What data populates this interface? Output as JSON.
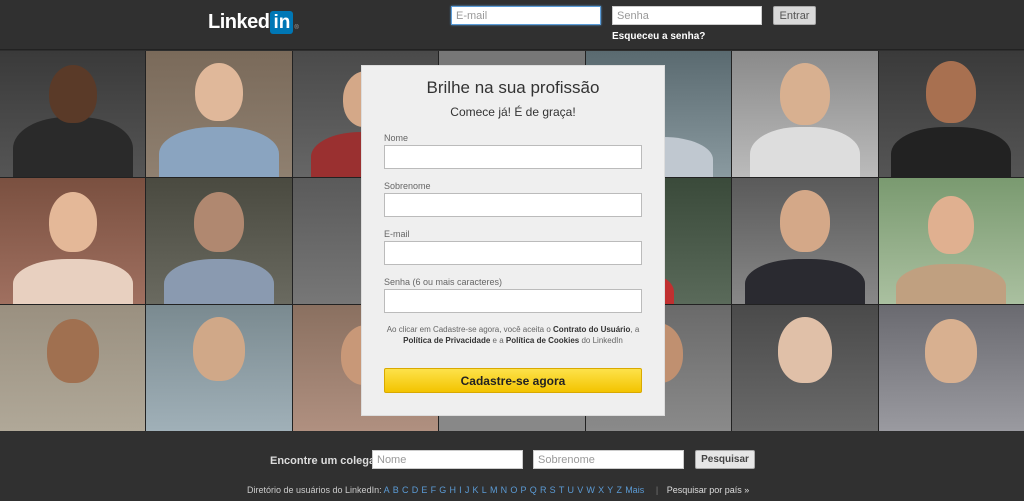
{
  "header": {
    "logo_text": "Linked",
    "logo_in": "in",
    "logo_reg": "®",
    "email_placeholder": "E-mail",
    "password_placeholder": "Senha",
    "login_button": "Entrar",
    "forgot_link": "Esqueceu a senha?"
  },
  "signup": {
    "title": "Brilhe na sua profissão",
    "subtitle": "Comece já! É de graça!",
    "first_name_label": "Nome",
    "last_name_label": "Sobrenome",
    "email_label": "E-mail",
    "password_label": "Senha (6 ou mais caracteres)",
    "terms_prefix": "Ao clicar em Cadastre-se agora, você aceita o ",
    "terms_contract": "Contrato do Usuário",
    "terms_mid1": ", a ",
    "terms_privacy": "Política de Privacidade",
    "terms_mid2": " e a ",
    "terms_cookies": "Política de Cookies",
    "terms_suffix": " do LinkedIn",
    "submit": "Cadastre-se agora"
  },
  "footer": {
    "find_label": "Encontre um colega:",
    "first_placeholder": "Nome",
    "last_placeholder": "Sobrenome",
    "search_button": "Pesquisar",
    "directory_label": "Diretório de usuários do LinkedIn:",
    "letters": [
      "A",
      "B",
      "C",
      "D",
      "E",
      "F",
      "G",
      "H",
      "I",
      "J",
      "K",
      "L",
      "M",
      "N",
      "O",
      "P",
      "Q",
      "R",
      "S",
      "T",
      "U",
      "V",
      "W",
      "X",
      "Y",
      "Z",
      "Mais"
    ],
    "country_link": "Pesquisar por país »"
  },
  "colors": {
    "brand": "#0077b5",
    "cta": "#f3c400"
  }
}
